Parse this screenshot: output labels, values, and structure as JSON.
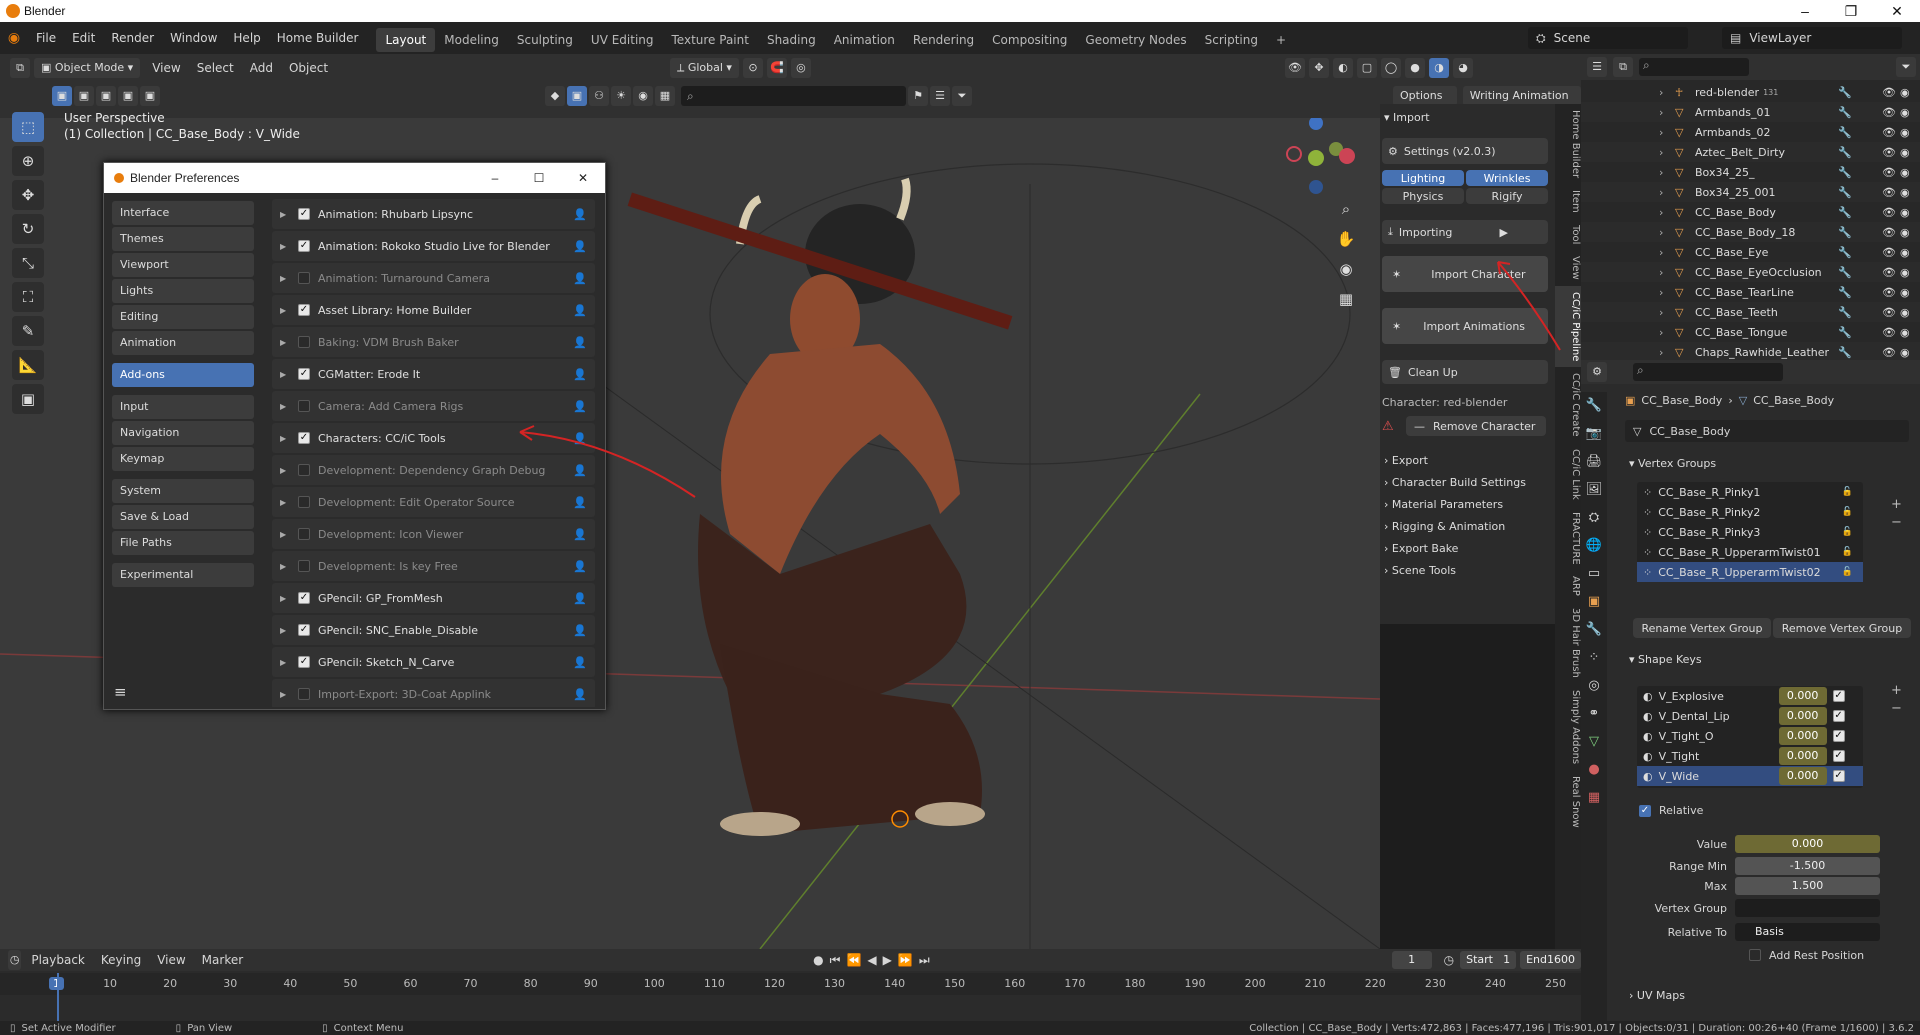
{
  "window": {
    "title": "Blender"
  },
  "menus": [
    "File",
    "Edit",
    "Render",
    "Window",
    "Help",
    "Home Builder"
  ],
  "workspaces": [
    "Layout",
    "Modeling",
    "Sculpting",
    "UV Editing",
    "Texture Paint",
    "Shading",
    "Animation",
    "Rendering",
    "Compositing",
    "Geometry Nodes",
    "Scripting",
    "+"
  ],
  "scene": {
    "name": "Scene",
    "view_layer": "ViewLayer"
  },
  "viewport_header": {
    "mode": "Object Mode",
    "items": [
      "View",
      "Select",
      "Add",
      "Object"
    ],
    "transform": "Global",
    "options": "Options",
    "writing": "Writing Animation"
  },
  "viewport": {
    "perspective": "User Perspective",
    "collection": "(1) Collection | CC_Base_Body : V_Wide"
  },
  "prefs": {
    "title": "Blender Preferences",
    "nav": [
      {
        "label": "Interface"
      },
      {
        "label": "Themes"
      },
      {
        "label": "Viewport"
      },
      {
        "label": "Lights"
      },
      {
        "label": "Editing"
      },
      {
        "label": "Animation"
      },
      {
        "label": "Add-ons",
        "selected": true
      },
      {
        "label": "Input"
      },
      {
        "label": "Navigation"
      },
      {
        "label": "Keymap"
      },
      {
        "label": "System"
      },
      {
        "label": "Save & Load"
      },
      {
        "label": "File Paths"
      },
      {
        "label": "Experimental"
      }
    ],
    "addons": [
      {
        "label": "Animation: Rhubarb Lipsync",
        "enabled": true
      },
      {
        "label": "Animation: Rokoko Studio Live for Blender",
        "enabled": true
      },
      {
        "label": "Animation: Turnaround Camera",
        "enabled": false
      },
      {
        "label": "Asset Library: Home Builder",
        "enabled": true
      },
      {
        "label": "Baking: VDM Brush Baker",
        "enabled": false
      },
      {
        "label": "CGMatter: Erode It",
        "enabled": true
      },
      {
        "label": "Camera: Add Camera Rigs",
        "enabled": false
      },
      {
        "label": "Characters: CC/iC Tools",
        "enabled": true
      },
      {
        "label": "Development: Dependency Graph Debug",
        "enabled": false
      },
      {
        "label": "Development: Edit Operator Source",
        "enabled": false
      },
      {
        "label": "Development: Icon Viewer",
        "enabled": false
      },
      {
        "label": "Development: Is key Free",
        "enabled": false
      },
      {
        "label": "GPencil: GP_FromMesh",
        "enabled": true
      },
      {
        "label": "GPencil: SNC_Enable_Disable",
        "enabled": true
      },
      {
        "label": "GPencil: Sketch_N_Carve",
        "enabled": true
      },
      {
        "label": "Import-Export: 3D-Coat Applink",
        "enabled": false
      }
    ]
  },
  "npanel": {
    "import_header": "Import",
    "settings": "Settings (v2.0.3)",
    "toggles": [
      "Lighting",
      "Wrinkles",
      "Physics",
      "Rigify"
    ],
    "importing": "Importing",
    "import_character": "Import Character",
    "import_animations": "Import Animations",
    "clean_up": "Clean Up",
    "character": "Character: red-blender",
    "remove_character": "Remove Character",
    "sections": [
      "Export",
      "Character Build Settings",
      "Material Parameters",
      "Rigging & Animation",
      "Export Bake",
      "Scene Tools"
    ]
  },
  "vtabs": [
    "Home Builder",
    "Item",
    "Tool",
    "View",
    "CC/iC Pipeline",
    "CC/iC Create",
    "CC/iC Link",
    "FRACTURE",
    "ARP",
    "3D Hair Brush",
    "Simply Addons",
    "Real Snow"
  ],
  "outliner": {
    "items": [
      {
        "label": "red-blender",
        "badge": "131"
      },
      {
        "label": "Armbands_01"
      },
      {
        "label": "Armbands_02"
      },
      {
        "label": "Aztec_Belt_Dirty"
      },
      {
        "label": "Box34_25_"
      },
      {
        "label": "Box34_25_001"
      },
      {
        "label": "CC_Base_Body"
      },
      {
        "label": "CC_Base_Body_18"
      },
      {
        "label": "CC_Base_Eye"
      },
      {
        "label": "CC_Base_EyeOcclusion"
      },
      {
        "label": "CC_Base_TearLine"
      },
      {
        "label": "CC_Base_Teeth"
      },
      {
        "label": "CC_Base_Tongue"
      },
      {
        "label": "Chaps_Rawhide_Leather"
      }
    ]
  },
  "properties": {
    "breadcrumb_obj": "CC_Base_Body",
    "breadcrumb_mesh": "CC_Base_Body",
    "mesh_name": "CC_Base_Body",
    "vertex_groups_title": "Vertex Groups",
    "vertex_groups": [
      "CC_Base_R_Pinky1",
      "CC_Base_R_Pinky2",
      "CC_Base_R_Pinky3",
      "CC_Base_R_UpperarmTwist01",
      "CC_Base_R_UpperarmTwist02"
    ],
    "rename_vg": "Rename Vertex Group",
    "remove_vg": "Remove Vertex Group",
    "shape_keys_title": "Shape Keys",
    "shape_keys": [
      {
        "name": "V_Explosive",
        "value": "0.000"
      },
      {
        "name": "V_Dental_Lip",
        "value": "0.000"
      },
      {
        "name": "V_Tight_O",
        "value": "0.000"
      },
      {
        "name": "V_Tight",
        "value": "0.000"
      },
      {
        "name": "V_Wide",
        "value": "0.000"
      }
    ],
    "relative": "Relative",
    "value_label": "Value",
    "value": "0.000",
    "range_min_label": "Range Min",
    "range_min": "-1.500",
    "max_label": "Max",
    "max": "1.500",
    "vertex_group_label": "Vertex Group",
    "relative_to_label": "Relative To",
    "relative_to": "Basis",
    "add_rest": "Add Rest Position",
    "uv_maps": "UV Maps"
  },
  "timeline": {
    "menus": [
      "Playback",
      "Keying",
      "View",
      "Marker"
    ],
    "current": "1",
    "start_label": "Start",
    "start": "1",
    "end_label": "End",
    "end": "1600",
    "ticks": [
      "1",
      "10",
      "20",
      "30",
      "40",
      "50",
      "60",
      "70",
      "80",
      "90",
      "100",
      "110",
      "120",
      "130",
      "140",
      "150",
      "160",
      "170",
      "180",
      "190",
      "200",
      "210",
      "220",
      "230",
      "240",
      "250"
    ]
  },
  "status": {
    "left1": "Set Active Modifier",
    "left2": "Pan View",
    "left3": "Context Menu",
    "right": "Collection | CC_Base_Body | Verts:472,863 | Faces:477,196 | Tris:901,017 | Objects:0/31 | Duration: 00:26+40 (Frame 1/1600) | 3.6.2"
  },
  "colors": {
    "accent": "#4772b3",
    "annotation": "#d42424",
    "shape_value": "#6e6a34"
  }
}
